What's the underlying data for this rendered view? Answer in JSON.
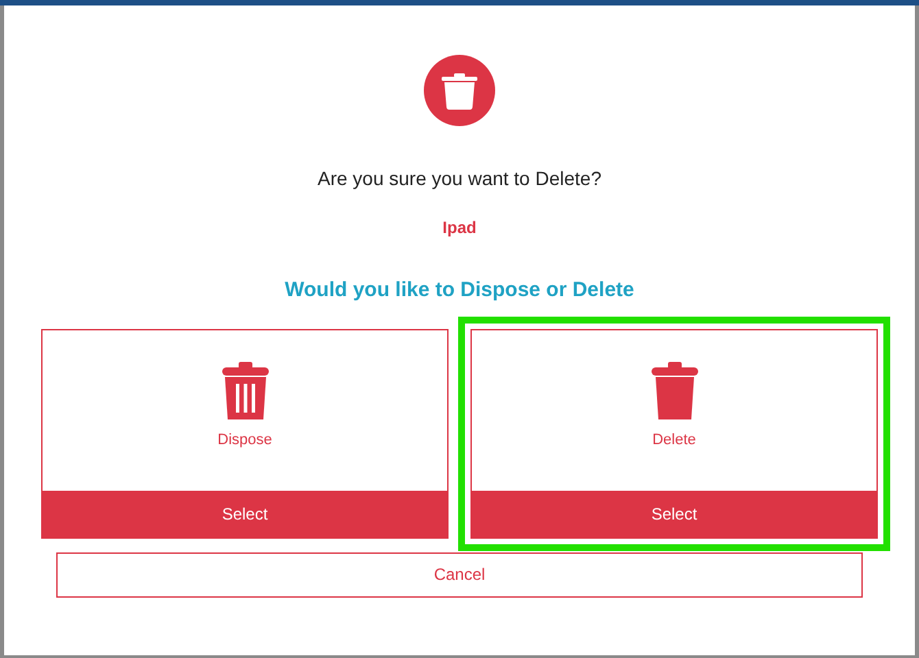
{
  "dialog": {
    "question": "Are you sure you want to Delete?",
    "item_name": "Ipad",
    "prompt": "Would you like to Dispose or Delete",
    "options": [
      {
        "kind": "dispose",
        "label": "Dispose",
        "button": "Select",
        "selected": false
      },
      {
        "kind": "delete",
        "label": "Delete",
        "button": "Select",
        "selected": true
      }
    ],
    "cancel": "Cancel"
  }
}
